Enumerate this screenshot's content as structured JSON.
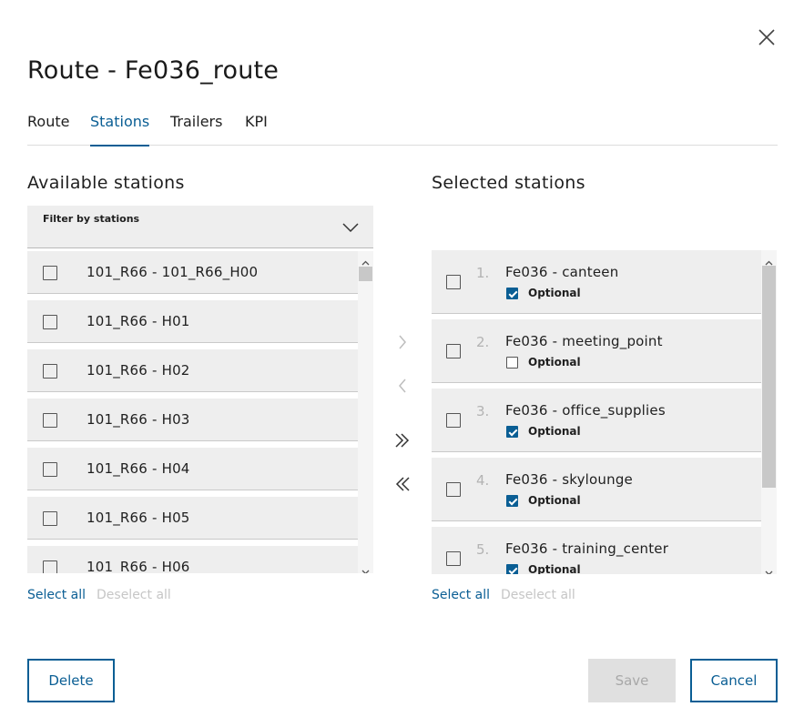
{
  "dialog": {
    "title": "Route - Fe036_route"
  },
  "tabs": [
    {
      "label": "Route"
    },
    {
      "label": "Stations"
    },
    {
      "label": "Trailers"
    },
    {
      "label": "KPI"
    }
  ],
  "active_tab": "Stations",
  "available": {
    "title": "Available stations",
    "filter_label": "Filter by stations",
    "items": [
      {
        "label": "101_R66 - 101_R66_H00",
        "checked": false
      },
      {
        "label": "101_R66 - H01",
        "checked": false
      },
      {
        "label": "101_R66 - H02",
        "checked": false
      },
      {
        "label": "101_R66 - H03",
        "checked": false
      },
      {
        "label": "101_R66 - H04",
        "checked": false
      },
      {
        "label": "101_R66 - H05",
        "checked": false
      },
      {
        "label": "101_R66 - H06",
        "checked": false
      }
    ],
    "select_all": "Select all",
    "deselect_all": "Deselect all"
  },
  "selected": {
    "title": "Selected stations",
    "items": [
      {
        "num": "1.",
        "label": "Fe036 - canteen",
        "optional_label": "Optional",
        "optional": true
      },
      {
        "num": "2.",
        "label": "Fe036 - meeting_point",
        "optional_label": "Optional",
        "optional": false
      },
      {
        "num": "3.",
        "label": "Fe036 - office_supplies",
        "optional_label": "Optional",
        "optional": true
      },
      {
        "num": "4.",
        "label": "Fe036 - skylounge",
        "optional_label": "Optional",
        "optional": true
      },
      {
        "num": "5.",
        "label": "Fe036 - training_center",
        "optional_label": "Optional",
        "optional": true
      }
    ],
    "select_all": "Select all",
    "deselect_all": "Deselect all"
  },
  "buttons": {
    "delete": "Delete",
    "save": "Save",
    "cancel": "Cancel"
  },
  "colors": {
    "accent": "#0a5e94",
    "row_bg": "#eeeeee",
    "disabled_text": "#c6c6c6"
  }
}
